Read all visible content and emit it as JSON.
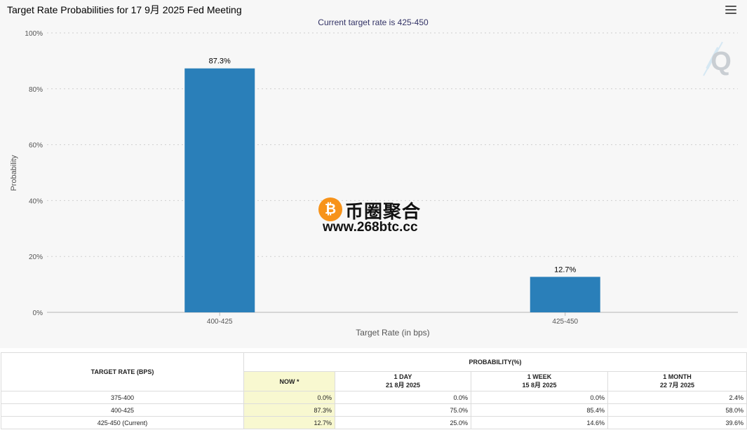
{
  "colors": {
    "bar": "#2a7fb9",
    "plot_background": "#f7f7f7",
    "now_column": "#f8f8d0"
  },
  "chart_data": {
    "type": "bar",
    "title": "Target Rate Probabilities for 17 9月 2025 Fed Meeting",
    "subtitle": "Current target rate is 425-450",
    "xlabel": "Target Rate (in bps)",
    "ylabel": "Probability",
    "categories": [
      "400-425",
      "425-450"
    ],
    "values": [
      87.3,
      12.7
    ],
    "data_labels": [
      "87.3%",
      "12.7%"
    ],
    "ylim": [
      0,
      100
    ],
    "yticks": [
      0,
      20,
      40,
      60,
      80,
      100
    ],
    "ytick_labels": [
      "0%",
      "20%",
      "40%",
      "60%",
      "80%",
      "100%"
    ],
    "grid": true
  },
  "watermark": {
    "coin_symbol": "₿",
    "name": "币圈聚合",
    "url": "www.268btc.cc"
  },
  "icons": {
    "menu": "hamburger-menu-icon",
    "logo": "q-logo-icon"
  },
  "table": {
    "rate_header": "TARGET RATE (BPS)",
    "prob_header": "PROBABILITY(%)",
    "columns": [
      {
        "label": "NOW *",
        "date": ""
      },
      {
        "label": "1 DAY",
        "date": "21 8月 2025"
      },
      {
        "label": "1 WEEK",
        "date": "15 8月 2025"
      },
      {
        "label": "1 MONTH",
        "date": "22 7月 2025"
      }
    ],
    "rows": [
      {
        "rate": "375-400",
        "values": [
          "0.0%",
          "0.0%",
          "0.0%",
          "2.4%"
        ]
      },
      {
        "rate": "400-425",
        "values": [
          "87.3%",
          "75.0%",
          "85.4%",
          "58.0%"
        ]
      },
      {
        "rate": "425-450 (Current)",
        "values": [
          "12.7%",
          "25.0%",
          "14.6%",
          "39.6%"
        ]
      }
    ]
  }
}
